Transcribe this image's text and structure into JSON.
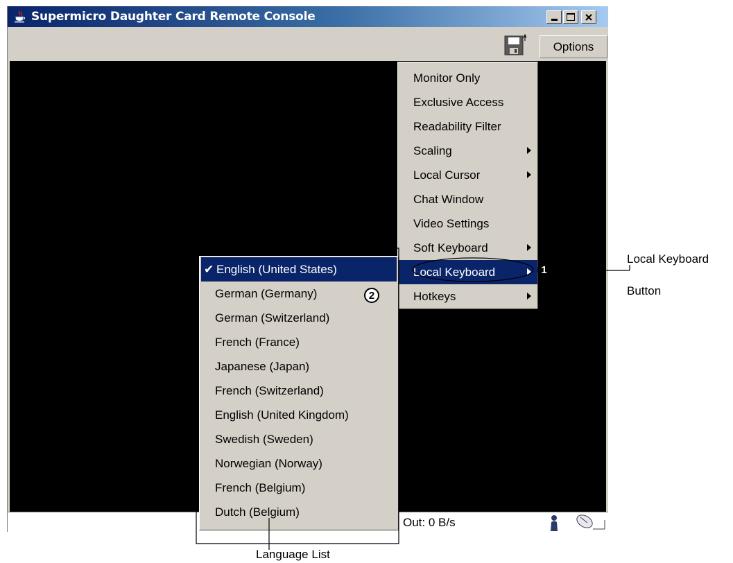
{
  "window": {
    "title": "Supermicro Daughter Card Remote Console",
    "controls": {
      "minimize": "_",
      "maximize": "□",
      "close": "×"
    }
  },
  "toolbar": {
    "save_icon": "floppy-disk-icon",
    "options_label": "Options"
  },
  "options_menu": {
    "items": [
      {
        "label": "Monitor Only",
        "submenu": false
      },
      {
        "label": "Exclusive Access",
        "submenu": false
      },
      {
        "label": "Readability Filter",
        "submenu": false
      },
      {
        "label": "Scaling",
        "submenu": true
      },
      {
        "label": "Local Cursor",
        "submenu": true
      },
      {
        "label": "Chat Window",
        "submenu": false
      },
      {
        "label": "Video Settings",
        "submenu": false
      },
      {
        "label": "Soft Keyboard",
        "submenu": true
      },
      {
        "label": "Local Keyboard",
        "submenu": true
      },
      {
        "label": "Hotkeys",
        "submenu": true
      }
    ]
  },
  "language_menu": {
    "selected": "English (United States)",
    "items": [
      "English (United States)",
      "German (Germany)",
      "German (Switzerland)",
      "French (France)",
      "Japanese (Japan)",
      "French (Switzerland)",
      "English (United Kingdom)",
      "Swedish (Sweden)",
      "Norwegian (Norway)",
      "French (Belgium)",
      "Dutch (Belgium)"
    ]
  },
  "status_bar": {
    "text": "Out: 0 B/s",
    "user_icon": "user-icon",
    "mouse_icon": "mouse-icon"
  },
  "annotations": {
    "callout_1": "1",
    "callout_2": "2",
    "label_1_line1": "Local Keyboard",
    "label_1_line2": "Button",
    "label_2": "Language List"
  },
  "colors": {
    "title_gradient_start": "#0a246a",
    "title_gradient_end": "#a6caf0",
    "menu_bg": "#d4d0c8",
    "selection_bg": "#0a246a",
    "screen_bg": "#000000"
  }
}
